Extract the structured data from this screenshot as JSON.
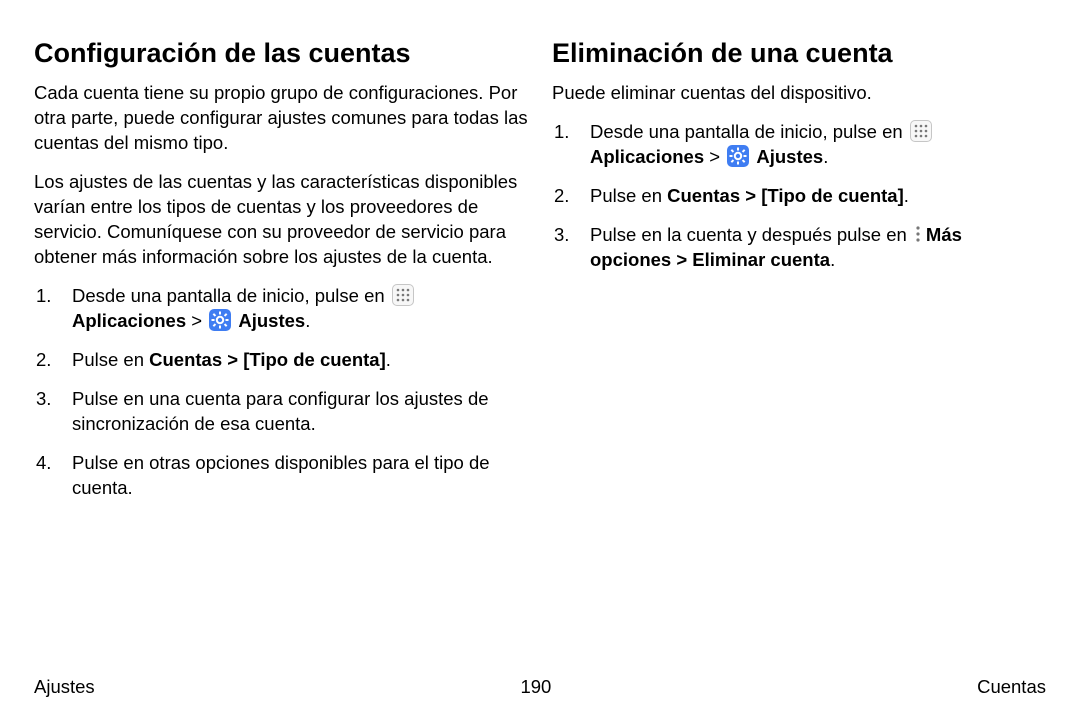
{
  "left": {
    "heading": "Configuración de las cuentas",
    "para1": "Cada cuenta tiene su propio grupo de configuraciones. Por otra parte, puede configurar ajustes comunes para todas las cuentas del mismo tipo.",
    "para2": "Los ajustes de las cuentas y las características disponibles varían entre los tipos de cuentas y los proveedores de servicio. Comuníquese con su proveedor de servicio para obtener más información sobre los ajustes de la cuenta.",
    "step1_pre": "Desde una pantalla de inicio, pulse en ",
    "apps_label": "Aplicaciones",
    "chevron": " > ",
    "settings_label": "Ajustes",
    "period": ".",
    "step2_pre": "Pulse en ",
    "step2_bold": "Cuentas > [Tipo de cuenta]",
    "step3": "Pulse en una cuenta para configurar los ajustes de sincronización de esa cuenta.",
    "step4": "Pulse en otras opciones disponibles para el tipo de cuenta."
  },
  "right": {
    "heading": "Eliminación de una cuenta",
    "para1": "Puede eliminar cuentas del dispositivo.",
    "step1_pre": "Desde una pantalla de inicio, pulse en ",
    "apps_label": "Aplicaciones",
    "chevron": " > ",
    "settings_label": "Ajustes",
    "period": ".",
    "step2_pre": "Pulse en ",
    "step2_bold": "Cuentas > [Tipo de cuenta]",
    "step3_pre": "Pulse en la cuenta y después pulse en ",
    "step3_bold": "Más opciones > Eliminar cuenta"
  },
  "footer": {
    "left": "Ajustes",
    "center": "190",
    "right": "Cuentas"
  }
}
